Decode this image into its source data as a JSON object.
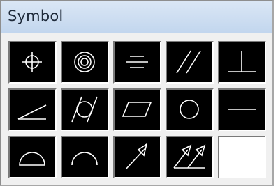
{
  "dialog": {
    "title": "Symbol"
  },
  "symbols": [
    {
      "name": "position"
    },
    {
      "name": "concentricity"
    },
    {
      "name": "symmetry"
    },
    {
      "name": "parallelism"
    },
    {
      "name": "perpendicularity"
    },
    {
      "name": "angularity"
    },
    {
      "name": "cylindricity"
    },
    {
      "name": "flatness"
    },
    {
      "name": "circularity"
    },
    {
      "name": "straightness"
    },
    {
      "name": "profile-of-surface"
    },
    {
      "name": "profile-of-line"
    },
    {
      "name": "circular-runout"
    },
    {
      "name": "total-runout"
    },
    {
      "name": "none"
    }
  ]
}
